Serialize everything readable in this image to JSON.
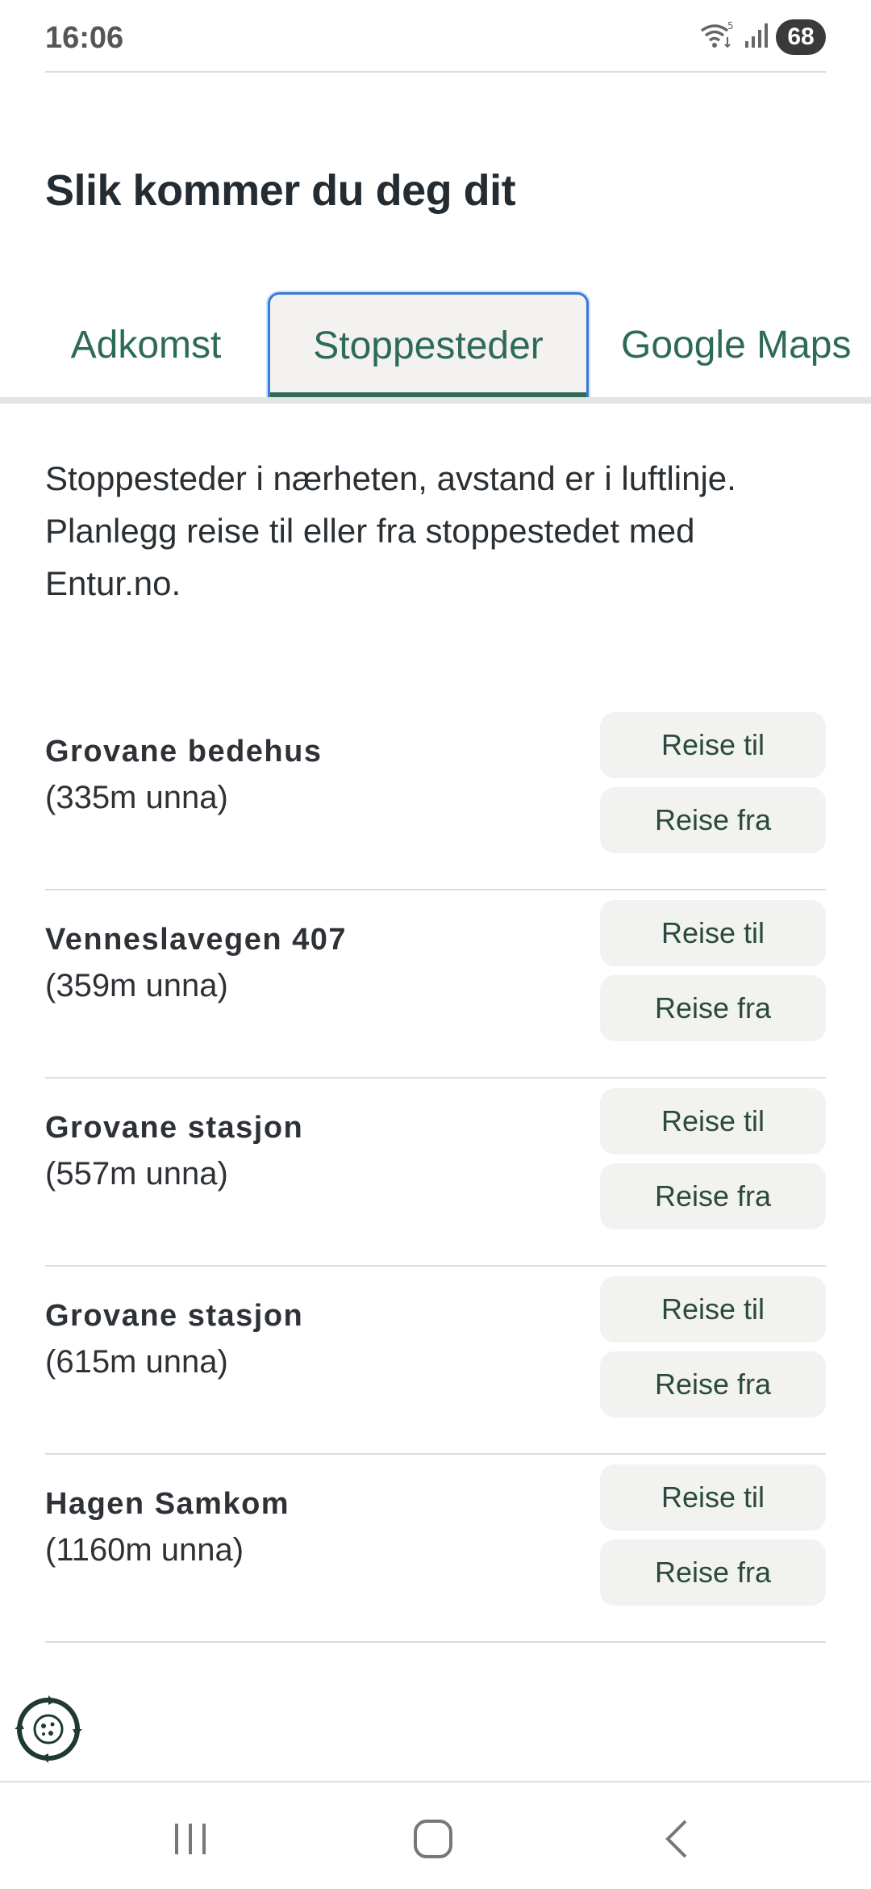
{
  "status_bar": {
    "time": "16:06",
    "battery": "68",
    "wifi_badge": "5"
  },
  "page": {
    "title": "Slik kommer du deg dit"
  },
  "tabs": [
    {
      "label": "Adkomst"
    },
    {
      "label": "Stoppesteder"
    },
    {
      "label": "Google Maps"
    }
  ],
  "description": "Stoppesteder i nærheten, avstand er i luftlinje. Planlegg reise til eller fra stoppestedet med Entur.no.",
  "stops": [
    {
      "name": "Grovane bedehus",
      "distance": "(335m unna)",
      "to_label": "Reise til",
      "from_label": "Reise fra"
    },
    {
      "name": "Venneslavegen 407",
      "distance": "(359m unna)",
      "to_label": "Reise til",
      "from_label": "Reise fra"
    },
    {
      "name": "Grovane stasjon",
      "distance": "(557m unna)",
      "to_label": "Reise til",
      "from_label": "Reise fra"
    },
    {
      "name": "Grovane stasjon",
      "distance": "(615m unna)",
      "to_label": "Reise til",
      "from_label": "Reise fra"
    },
    {
      "name": "Hagen Samkom",
      "distance": "(1160m unna)",
      "to_label": "Reise til",
      "from_label": "Reise fra"
    }
  ],
  "colors": {
    "accent": "#2e6b56",
    "focus": "#3a7bd5",
    "button_bg": "#f2f2f0"
  }
}
